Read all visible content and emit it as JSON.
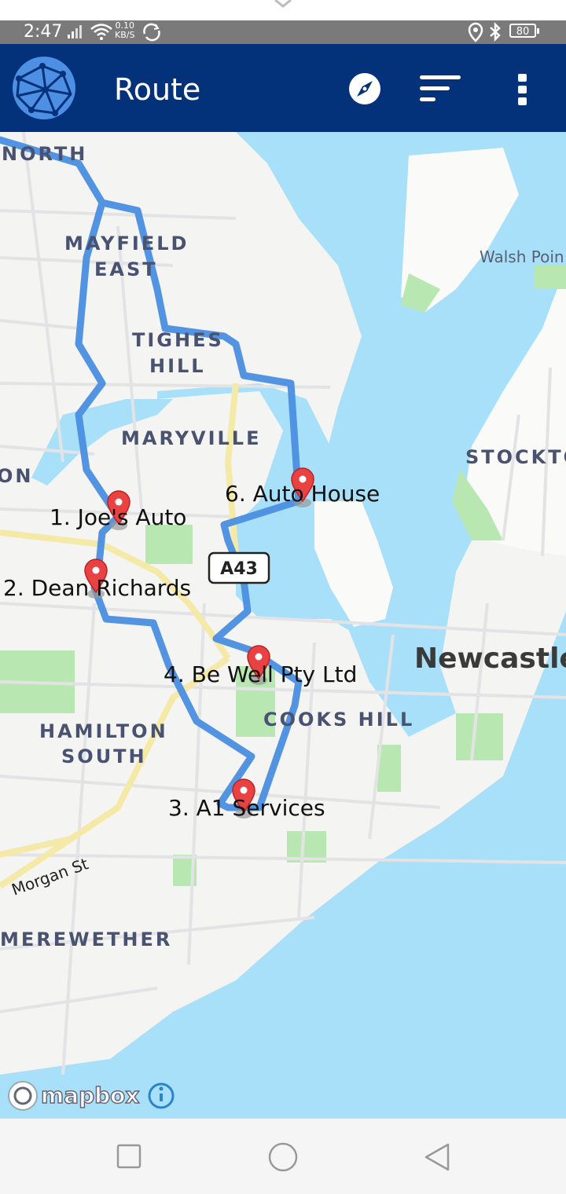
{
  "status_bar": {
    "time": "2:47",
    "net_speed_value": "0.10",
    "net_speed_unit": "KB/S",
    "battery": "80"
  },
  "app_bar": {
    "title": "Route",
    "logo_icon": "globe-logo-icon",
    "compass_icon": "compass-icon",
    "sort_icon": "sort-icon",
    "more_icon": "more-vert-icon",
    "color": "#03317a"
  },
  "map": {
    "route_color": "#4a8ee0",
    "water_color": "#a8e0fa",
    "areas": {
      "mayfield_north": "NORTH",
      "mayfield_east_1": "MAYFIELD",
      "mayfield_east_2": "EAST",
      "tighes_hill_1": "TIGHES",
      "tighes_hill_2": "HILL",
      "maryville": "MARYVILLE",
      "stockton": "STOCKTO",
      "cooks_hill": "COOKS HILL",
      "hamilton_south_1": "HAMILTON",
      "hamilton_south_2": "SOUTH",
      "merewether": "MEREWETHER",
      "edge_on": "ON"
    },
    "places": {
      "newcastle": "Newcastle",
      "walsh_point": "Walsh Poin",
      "morgan_st": "Morgan St",
      "road_shield": "A43"
    },
    "stops": [
      {
        "label": "1. Joe's Auto"
      },
      {
        "label": "2. Dean Richards"
      },
      {
        "label": "3. A1 Services"
      },
      {
        "label": "4. Be Well Pty Ltd"
      },
      {
        "label": "6. Auto House"
      }
    ],
    "attribution": "mapbox"
  },
  "nav_bar": {
    "recents": "recents-square-icon",
    "home": "home-circle-icon",
    "back": "back-triangle-icon"
  }
}
